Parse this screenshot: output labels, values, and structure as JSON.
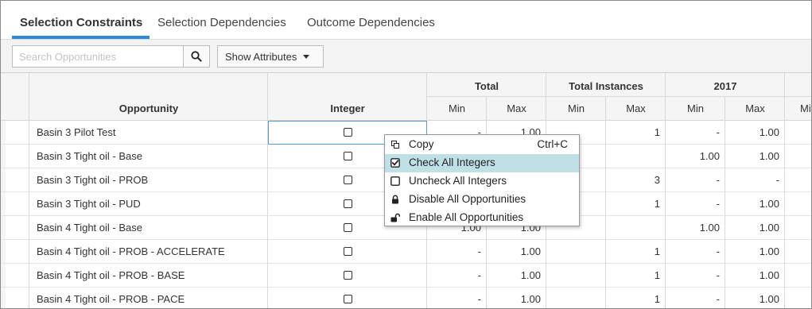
{
  "tabs": [
    {
      "label": "Selection Constraints",
      "active": true
    },
    {
      "label": "Selection Dependencies",
      "active": false
    },
    {
      "label": "Outcome Dependencies",
      "active": false
    }
  ],
  "toolbar": {
    "search_placeholder": "Search Opportunities",
    "search_value": "",
    "show_attributes_label": "Show Attributes"
  },
  "grid": {
    "headers": {
      "opportunity": "Opportunity",
      "integer": "Integer",
      "groups": [
        "Total",
        "Total Instances",
        "2017"
      ],
      "min": "Min",
      "max": "Max",
      "partial": "Mi"
    },
    "rows": [
      {
        "name": "Basin 3 Pilot Test",
        "total_min": "-",
        "total_max": "1.00",
        "inst_min": "",
        "inst_max": "1",
        "y_min": "-",
        "y_max": "1.00"
      },
      {
        "name": "Basin 3 Tight oil - Base",
        "total_min": "",
        "total_max": "",
        "inst_min": "",
        "inst_max": "",
        "y_min": "1.00",
        "y_max": "1.00"
      },
      {
        "name": "Basin 3 Tight oil - PROB",
        "total_min": "",
        "total_max": "",
        "inst_min": "",
        "inst_max": "3",
        "y_min": "-",
        "y_max": "-"
      },
      {
        "name": "Basin 3 Tight oil - PUD",
        "total_min": "",
        "total_max": "",
        "inst_min": "",
        "inst_max": "1",
        "y_min": "-",
        "y_max": "1.00"
      },
      {
        "name": "Basin 4 Tight oil - Base",
        "total_min": "1.00",
        "total_max": "1.00",
        "inst_min": "",
        "inst_max": "",
        "y_min": "1.00",
        "y_max": "1.00"
      },
      {
        "name": "Basin 4 Tight oil - PROB - ACCELERATE",
        "total_min": "-",
        "total_max": "1.00",
        "inst_min": "",
        "inst_max": "1",
        "y_min": "-",
        "y_max": "1.00"
      },
      {
        "name": "Basin 4 Tight oil - PROB - BASE",
        "total_min": "-",
        "total_max": "1.00",
        "inst_min": "",
        "inst_max": "1",
        "y_min": "-",
        "y_max": "1.00"
      },
      {
        "name": "Basin 4 Tight oil - PROB - PACE",
        "total_min": "-",
        "total_max": "1.00",
        "inst_min": "",
        "inst_max": "1",
        "y_min": "-",
        "y_max": "1.00"
      }
    ]
  },
  "context_menu": {
    "items": [
      {
        "label": "Copy",
        "shortcut": "Ctrl+C",
        "icon": "copy-icon"
      },
      {
        "label": "Check All Integers",
        "shortcut": "",
        "icon": "checked-box-icon",
        "highlighted": true
      },
      {
        "label": "Uncheck All Integers",
        "shortcut": "",
        "icon": "unchecked-box-icon"
      },
      {
        "label": "Disable All Opportunities",
        "shortcut": "",
        "icon": "lock-icon"
      },
      {
        "label": "Enable All Opportunities",
        "shortcut": "",
        "icon": "unlock-icon"
      }
    ]
  },
  "colors": {
    "accent": "#2e8ad8",
    "menu_highlight": "#bfe0e5",
    "selected_cell_border": "#5b9bd5"
  }
}
